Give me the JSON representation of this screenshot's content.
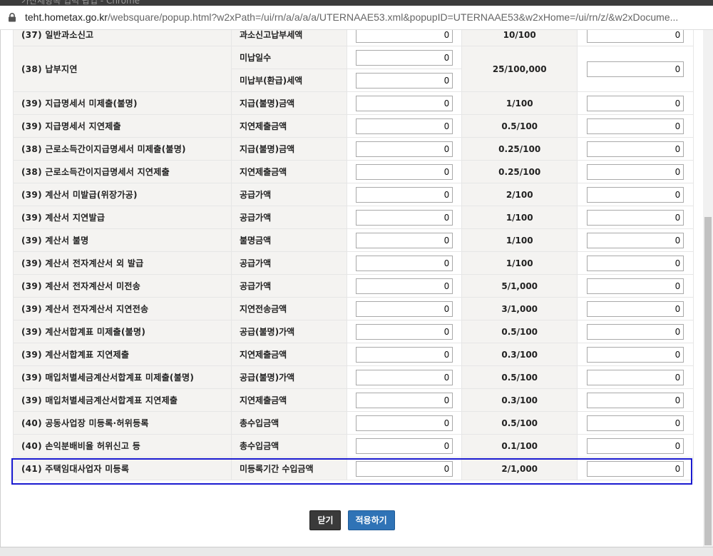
{
  "window": {
    "title": "가산세항목 입력 팝업 - Chrome"
  },
  "address": {
    "domain": "teht.hometax.go.kr",
    "path": "/websquare/popup.html?w2xPath=/ui/rn/a/a/a/a/UTERNAAE53.xml&popupID=UTERNAAE53&w2xHome=/ui/rn/z/&w2xDocume..."
  },
  "rows": [
    {
      "item": "(37) 일반과소신고",
      "basis": "과소신고납부세액",
      "amount": "0",
      "rate": "10/100",
      "tax": "0"
    },
    {
      "item": "(38) 납부지연",
      "basis_a": "미납일수",
      "amount_a": "0",
      "basis_b": "미납부(환급)세액",
      "amount_b": "0",
      "rate": "25/100,000",
      "tax": "0"
    },
    {
      "item": "(39) 지급명세서 미제출(불명)",
      "basis": "지급(불명)금액",
      "amount": "0",
      "rate": "1/100",
      "tax": "0"
    },
    {
      "item": "(39) 지급명세서 지연제출",
      "basis": "지연제출금액",
      "amount": "0",
      "rate": "0.5/100",
      "tax": "0"
    },
    {
      "item": "(38) 근로소득간이지급명세서 미제출(불명)",
      "basis": "지급(불명)금액",
      "amount": "0",
      "rate": "0.25/100",
      "tax": "0"
    },
    {
      "item": "(38) 근로소득간이지급명세서 지연제출",
      "basis": "지연제출금액",
      "amount": "0",
      "rate": "0.25/100",
      "tax": "0"
    },
    {
      "item": "(39) 계산서 미발급(위장가공)",
      "basis": "공급가액",
      "amount": "0",
      "rate": "2/100",
      "tax": "0"
    },
    {
      "item": "(39) 계산서 지연발급",
      "basis": "공급가액",
      "amount": "0",
      "rate": "1/100",
      "tax": "0"
    },
    {
      "item": "(39) 계산서 불명",
      "basis": "불명금액",
      "amount": "0",
      "rate": "1/100",
      "tax": "0"
    },
    {
      "item": "(39) 계산서 전자계산서 외 발급",
      "basis": "공급가액",
      "amount": "0",
      "rate": "1/100",
      "tax": "0"
    },
    {
      "item": "(39) 계산서 전자계산서 미전송",
      "basis": "공급가액",
      "amount": "0",
      "rate": "5/1,000",
      "tax": "0"
    },
    {
      "item": "(39) 계산서 전자계산서 지연전송",
      "basis": "지연전송금액",
      "amount": "0",
      "rate": "3/1,000",
      "tax": "0"
    },
    {
      "item": "(39) 계산서합계표 미제출(불명)",
      "basis": "공급(불명)가액",
      "amount": "0",
      "rate": "0.5/100",
      "tax": "0"
    },
    {
      "item": "(39) 계산서합계표 지연제출",
      "basis": "지연제출금액",
      "amount": "0",
      "rate": "0.3/100",
      "tax": "0"
    },
    {
      "item": "(39) 매입처별세금계산서합계표 미제출(불명)",
      "basis": "공급(불명)가액",
      "amount": "0",
      "rate": "0.5/100",
      "tax": "0"
    },
    {
      "item": "(39) 매입처별세금계산서합계표 지연제출",
      "basis": "지연제출금액",
      "amount": "0",
      "rate": "0.3/100",
      "tax": "0"
    },
    {
      "item": "(40) 공동사업장 미등록·허위등록",
      "basis": "총수입금액",
      "amount": "0",
      "rate": "0.5/100",
      "tax": "0"
    },
    {
      "item": "(40) 손익분배비율 허위신고 등",
      "basis": "총수입금액",
      "amount": "0",
      "rate": "0.1/100",
      "tax": "0"
    },
    {
      "item": "(41) 주택임대사업자 미등록",
      "basis": "미등록기간 수입금액",
      "amount": "0",
      "rate": "2/1,000",
      "tax": "0"
    }
  ],
  "buttons": {
    "close": "닫기",
    "apply": "적용하기"
  },
  "colors": {
    "highlight": "#1b1bd0",
    "apply_button": "#2f73b6",
    "close_button": "#3a3a3a"
  }
}
